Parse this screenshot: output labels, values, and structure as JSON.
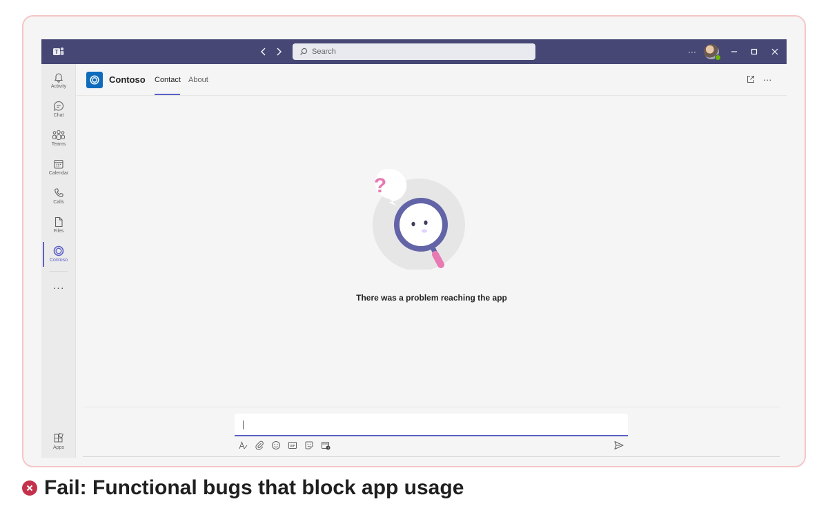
{
  "titlebar": {
    "search_placeholder": "Search",
    "more_label": "···"
  },
  "rail": {
    "items": [
      {
        "label": "Activity",
        "icon": "bell-icon"
      },
      {
        "label": "Chat",
        "icon": "chat-icon"
      },
      {
        "label": "Teams",
        "icon": "teams-icon"
      },
      {
        "label": "Calendar",
        "icon": "calendar-icon"
      },
      {
        "label": "Calls",
        "icon": "phone-icon"
      },
      {
        "label": "Files",
        "icon": "file-icon"
      },
      {
        "label": "Contoso",
        "icon": "contoso-icon"
      }
    ],
    "more": "···",
    "apps_label": "Apps"
  },
  "app": {
    "name": "Contoso",
    "tabs": [
      {
        "label": "Contact",
        "active": true
      },
      {
        "label": "About",
        "active": false
      }
    ],
    "more": "···"
  },
  "main": {
    "message": "There was a problem reaching the app"
  },
  "compose": {
    "tools": [
      "format-icon",
      "attach-icon",
      "emoji-icon",
      "gif-icon",
      "sticker-icon",
      "schedule-meeting-icon"
    ]
  },
  "caption": {
    "text": "Fail: Functional bugs that block app usage"
  },
  "colors": {
    "titlebar": "#464775",
    "accent": "#5b5fc7",
    "fail": "#c4314b",
    "frame_border": "#f5c6c6"
  }
}
